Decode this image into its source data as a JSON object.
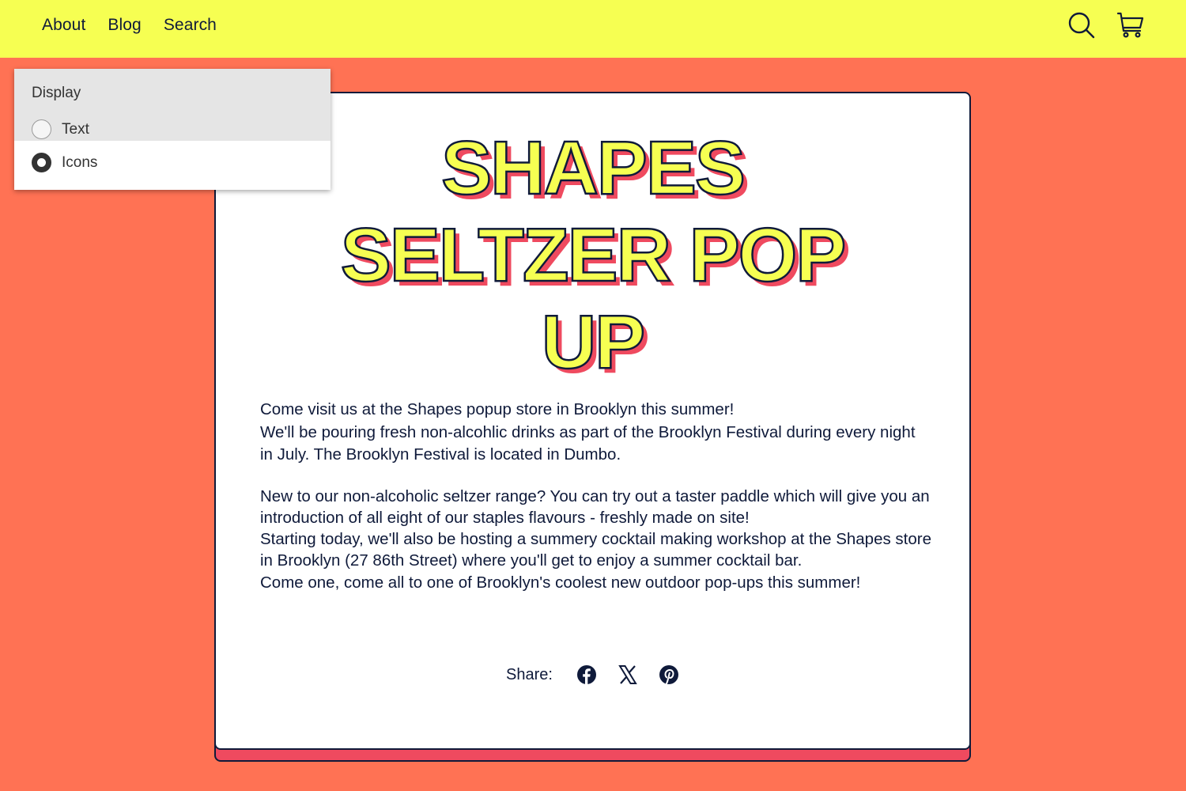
{
  "header": {
    "nav": [
      {
        "label": "About"
      },
      {
        "label": "Blog"
      },
      {
        "label": "Search"
      }
    ],
    "icons": [
      "search-icon",
      "cart-icon"
    ],
    "background_color": "#f6ff52"
  },
  "display_menu": {
    "heading": "Display",
    "options": [
      {
        "label": "Text",
        "selected": false
      },
      {
        "label": "Icons",
        "selected": true
      }
    ]
  },
  "article": {
    "title": "SHAPES SELTZER POP UP",
    "paragraphs": [
      "Come visit us at the Shapes popup store in Brooklyn this summer!\nWe'll be pouring fresh non-alcohlic drinks as part of the Brooklyn Festival during every night in July. The Brooklyn Festival is located in Dumbo.",
      "New to our non-alcoholic seltzer range? You can try out a taster paddle which will give you an introduction of all eight of our staples flavours - freshly made on site!\nStarting today, we'll also be hosting a summery cocktail making workshop at the Shapes store in Brooklyn (27 86th Street) where you'll get to enjoy a summer cocktail bar.\nCome one, come all to one of Brooklyn's coolest new outdoor pop-ups this summer!"
    ],
    "share_label": "Share:",
    "share_icons": [
      "facebook-icon",
      "x-icon",
      "pinterest-icon"
    ]
  },
  "colors": {
    "page_background": "#ff7254",
    "title_fill": "#f6ff52",
    "title_shadow": "#ef4a5f",
    "ink": "#0f1a3a"
  }
}
